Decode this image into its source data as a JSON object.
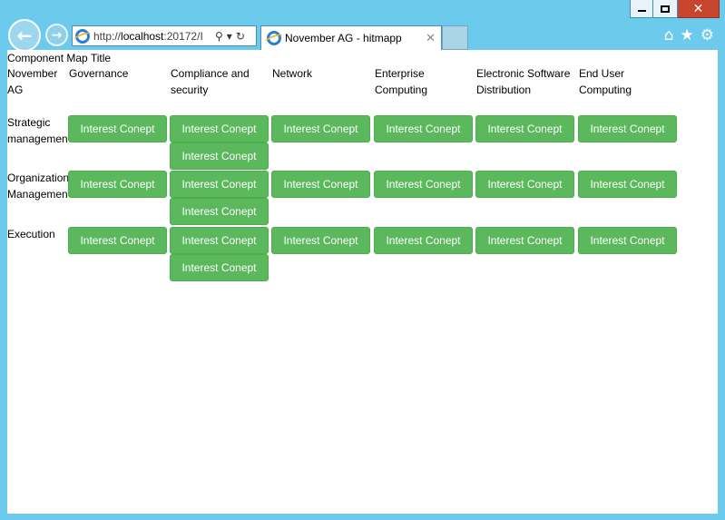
{
  "browser": {
    "url_prefix": "http://",
    "url_host": "localhost",
    "url_rest": ":20172/I",
    "tab_title": "November AG - hitmapp"
  },
  "page": {
    "title": "Component Map Title",
    "corner_label": "November AG",
    "columns": [
      "Governance",
      "Compliance and security",
      "Network",
      "Enterprise Computing",
      "Electronic Software Distribution",
      "End User Computing"
    ],
    "rows": [
      {
        "label": "Strategic management"
      },
      {
        "label": "Organization Management"
      },
      {
        "label": "Execution"
      }
    ],
    "button_label": "Interest Conept"
  },
  "colors": {
    "button": "#5cb85c",
    "frame": "#6ccbec",
    "close": "#c7452f"
  }
}
